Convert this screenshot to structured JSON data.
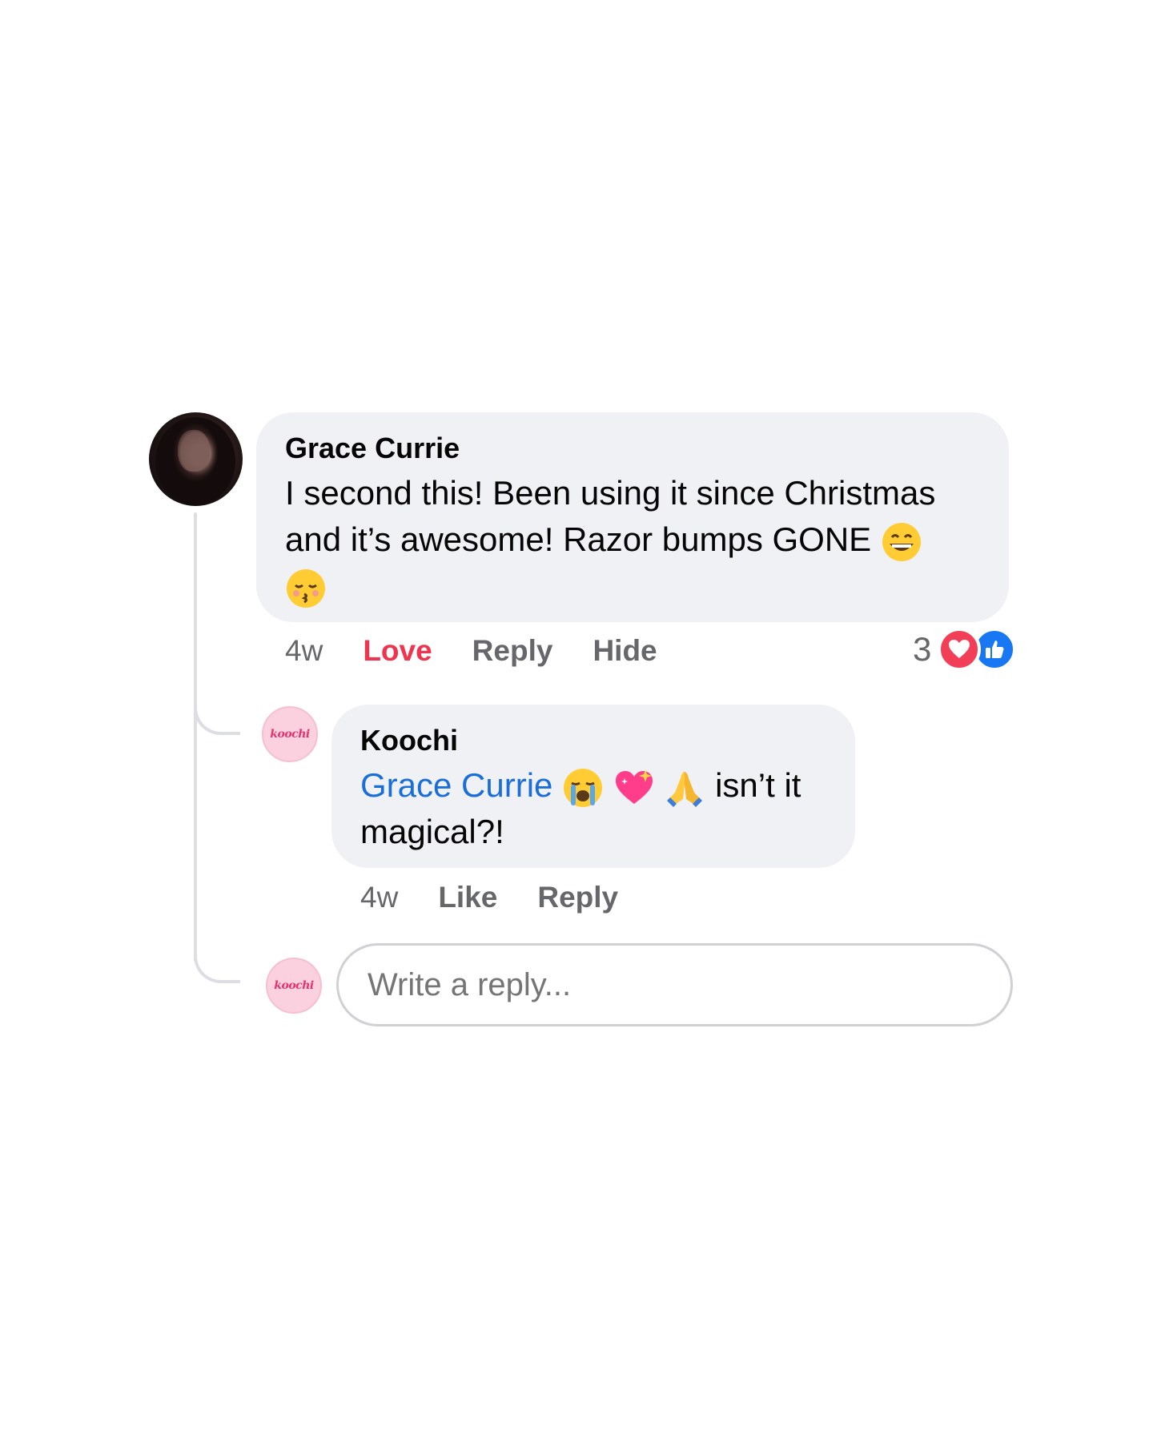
{
  "comment": {
    "author": "Grace Currie",
    "text_line1": "I second this! Been using it since Christmas",
    "text_line2": "and it’s awesome! Razor bumps GONE",
    "time": "4w",
    "love_label": "Love",
    "reply_label": "Reply",
    "hide_label": "Hide",
    "reaction_count": "3",
    "reactions": [
      "love-icon",
      "like-icon"
    ]
  },
  "reply": {
    "author": "Koochi",
    "mention": "Grace Currie",
    "text_after_emojis": "isn’t it",
    "text_line2": "magical?!",
    "time": "4w",
    "like_label": "Like",
    "reply_label": "Reply"
  },
  "avatar_logo": "koochi",
  "reply_box": {
    "placeholder": "Write a reply..."
  },
  "colors": {
    "bubble": "#f0f1f4",
    "mention": "#1a6ed8",
    "love": "#f0344f",
    "like": "#1877f2",
    "muted": "#65676b"
  }
}
